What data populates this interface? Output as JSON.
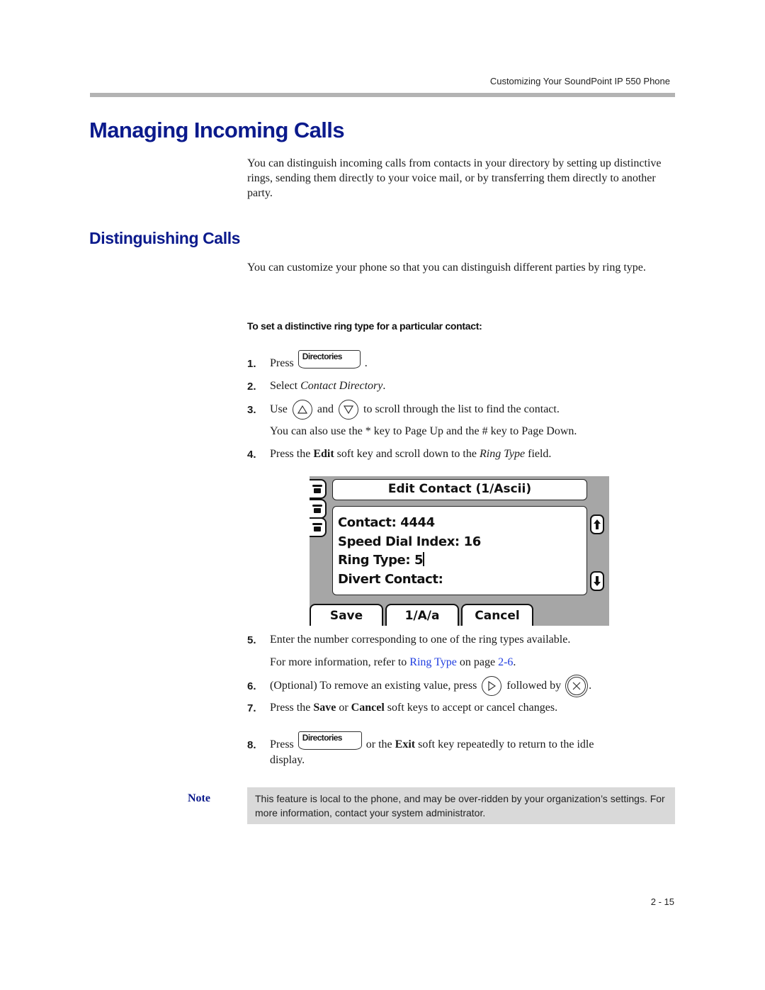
{
  "header": {
    "running_title": "Customizing Your SoundPoint IP 550 Phone"
  },
  "section": {
    "title": "Managing Incoming Calls",
    "intro": "You can distinguish incoming calls from contacts in your directory by setting up distinctive rings, sending them directly to your voice mail, or by transferring them directly to another party."
  },
  "subsection": {
    "title": "Distinguishing Calls",
    "intro": "You can customize your phone so that you can distinguish different parties by ring type.",
    "procedure_heading": "To set a distinctive ring type for a particular contact:"
  },
  "steps": [
    {
      "num": "1.",
      "text_before": "Press",
      "key_label": "Directories",
      "text_after": "."
    },
    {
      "num": "2.",
      "text_before": "Select ",
      "italic": "Contact Directory",
      "text_after": "."
    },
    {
      "num": "3.",
      "text_before": "Use",
      "text_mid": "and",
      "text_after": "to scroll through the list to find the contact.",
      "sub": "You can also use the * key to Page Up and the # key to Page Down."
    },
    {
      "num": "4.",
      "text_before": "Press the ",
      "bold": "Edit",
      "text_mid": " soft key and scroll down to the ",
      "italic": "Ring Type",
      "text_after": " field."
    },
    {
      "num": "5.",
      "text": "Enter the number corresponding to one of the ring types available.",
      "sub_before": "For more information, refer to ",
      "sub_link": "Ring Type",
      "sub_mid": " on page ",
      "sub_page_link": "2-6",
      "sub_after": "."
    },
    {
      "num": "6.",
      "text_before": "(Optional) To remove an existing value, press",
      "text_mid": "followed by",
      "text_after": "."
    },
    {
      "num": "7.",
      "text_before": "Press the ",
      "bold1": "Save",
      "text_mid": " or ",
      "bold2": "Cancel",
      "text_after": " soft keys to accept or cancel changes."
    },
    {
      "num": "8.",
      "text_before": "Press",
      "key_label": "Directories",
      "text_mid": "or the ",
      "bold": "Exit",
      "text_after": " soft key repeatedly to return to the idle",
      "line2": "display."
    }
  ],
  "phone_screen": {
    "title": "Edit Contact (1/Ascii)",
    "fields": [
      "Contact: 4444",
      "Speed Dial Index: 16",
      "Ring Type: 5",
      "Divert Contact:"
    ],
    "softkeys": [
      "Save",
      "1/A/a",
      "Cancel"
    ],
    "line_keys": [
      "phone-line-1",
      "phone-line-2",
      "phone-line-3"
    ]
  },
  "note": {
    "label": "Note",
    "text": "This feature is local to the phone, and may be over-ridden by your organization’s settings. For more information, contact your system administrator."
  },
  "footer": {
    "page_number": "2 - 15"
  },
  "colors": {
    "heading": "#0b1a8c",
    "link": "#1f3de0",
    "note_bg": "#d9d9d9",
    "rule": "#b3b3b3",
    "screen_bg": "#a6a6a6"
  }
}
